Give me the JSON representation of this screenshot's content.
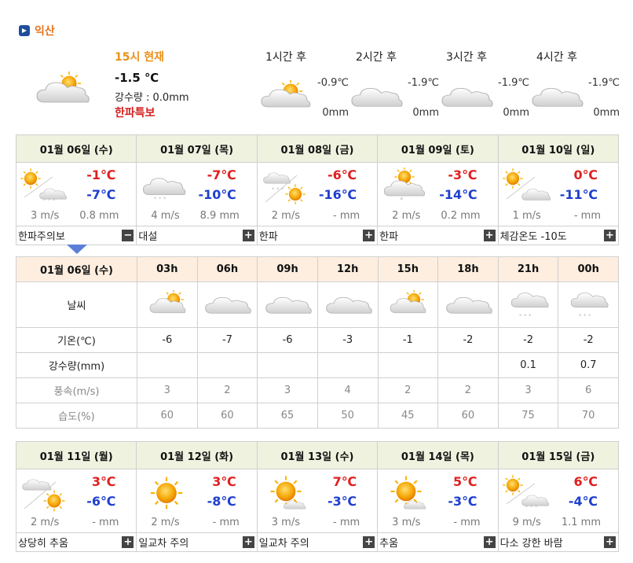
{
  "location": {
    "name": "익산",
    "icon": "location-arrow-icon"
  },
  "current": {
    "time": "15시 현재",
    "temp": "-1.5 ℃",
    "rain": "강수량 : 0.0mm",
    "alert": "한파특보",
    "icon": "partly-cloudy-icon"
  },
  "hourly_preview": [
    {
      "label": "1시간 후",
      "temp": "-0.9℃",
      "rain": "0mm",
      "icon": "partly-cloudy-icon"
    },
    {
      "label": "2시간 후",
      "temp": "-1.9℃",
      "rain": "0mm",
      "icon": "cloudy-icon"
    },
    {
      "label": "3시간 후",
      "temp": "-1.9℃",
      "rain": "0mm",
      "icon": "cloudy-icon"
    },
    {
      "label": "4시간 후",
      "temp": "-1.9℃",
      "rain": "0mm",
      "icon": "cloudy-icon"
    }
  ],
  "week1": [
    {
      "date": "01월 06일 (수)",
      "max": "-1℃",
      "min": "-7℃",
      "wind": "3 m/s",
      "rain": "0.8 mm",
      "note": "한파주의보",
      "toggle": "−",
      "icon": "sun-snow-icon"
    },
    {
      "date": "01월 07일 (목)",
      "max": "-7℃",
      "min": "-10℃",
      "wind": "4 m/s",
      "rain": "8.9 mm",
      "note": "대설",
      "toggle": "+",
      "icon": "snow-icon"
    },
    {
      "date": "01월 08일 (금)",
      "max": "-6℃",
      "min": "-16℃",
      "wind": "2 m/s",
      "rain": "- mm",
      "note": "한파",
      "toggle": "+",
      "icon": "snow-sun-icon"
    },
    {
      "date": "01월 09일 (토)",
      "max": "-3℃",
      "min": "-14℃",
      "wind": "2 m/s",
      "rain": "0.2 mm",
      "note": "한파",
      "toggle": "+",
      "icon": "sun-cloud-snow-icon"
    },
    {
      "date": "01월 10일 (일)",
      "max": "0℃",
      "min": "-11℃",
      "wind": "1 m/s",
      "rain": "- mm",
      "note": "체감온도 -10도",
      "toggle": "+",
      "icon": "sun-cloud-icon"
    }
  ],
  "hourly_table": {
    "date": "01월 06일 (수)",
    "hours": [
      "03h",
      "06h",
      "09h",
      "12h",
      "15h",
      "18h",
      "21h",
      "00h"
    ],
    "icons": [
      "partly-cloudy-icon",
      "cloudy-icon",
      "cloudy-icon",
      "cloudy-icon",
      "partly-cloudy-icon",
      "cloudy-icon",
      "snow-icon",
      "snow-icon"
    ],
    "rows": [
      {
        "label": "날씨"
      },
      {
        "label": "기온(℃)",
        "values": [
          "-6",
          "-7",
          "-6",
          "-3",
          "-1",
          "-2",
          "-2",
          "-2"
        ]
      },
      {
        "label": "강수량(mm)",
        "values": [
          "",
          "",
          "",
          "",
          "",
          "",
          "0.1",
          "0.7"
        ]
      },
      {
        "label": "풍속(m/s)",
        "values": [
          "3",
          "2",
          "3",
          "4",
          "2",
          "2",
          "3",
          "6"
        ]
      },
      {
        "label": "습도(%)",
        "values": [
          "60",
          "60",
          "65",
          "50",
          "45",
          "60",
          "75",
          "70"
        ]
      }
    ]
  },
  "week2": [
    {
      "date": "01월 11일 (월)",
      "max": "3℃",
      "min": "-6℃",
      "wind": "2 m/s",
      "rain": "- mm",
      "note": "상당히 추움",
      "toggle": "+",
      "icon": "cloud-sun-icon"
    },
    {
      "date": "01월 12일 (화)",
      "max": "3℃",
      "min": "-8℃",
      "wind": "2 m/s",
      "rain": "- mm",
      "note": "일교차 주의",
      "toggle": "+",
      "icon": "sun-icon"
    },
    {
      "date": "01월 13일 (수)",
      "max": "7℃",
      "min": "-3℃",
      "wind": "3 m/s",
      "rain": "- mm",
      "note": "일교차 주의",
      "toggle": "+",
      "icon": "sun-small-cloud-icon"
    },
    {
      "date": "01월 14일 (목)",
      "max": "5℃",
      "min": "-3℃",
      "wind": "3 m/s",
      "rain": "- mm",
      "note": "추움",
      "toggle": "+",
      "icon": "sun-small-cloud-icon"
    },
    {
      "date": "01월 15일 (금)",
      "max": "6℃",
      "min": "-4℃",
      "wind": "9 m/s",
      "rain": "1.1 mm",
      "note": "다소 강한 바람",
      "toggle": "+",
      "icon": "sun-snow-icon"
    }
  ]
}
